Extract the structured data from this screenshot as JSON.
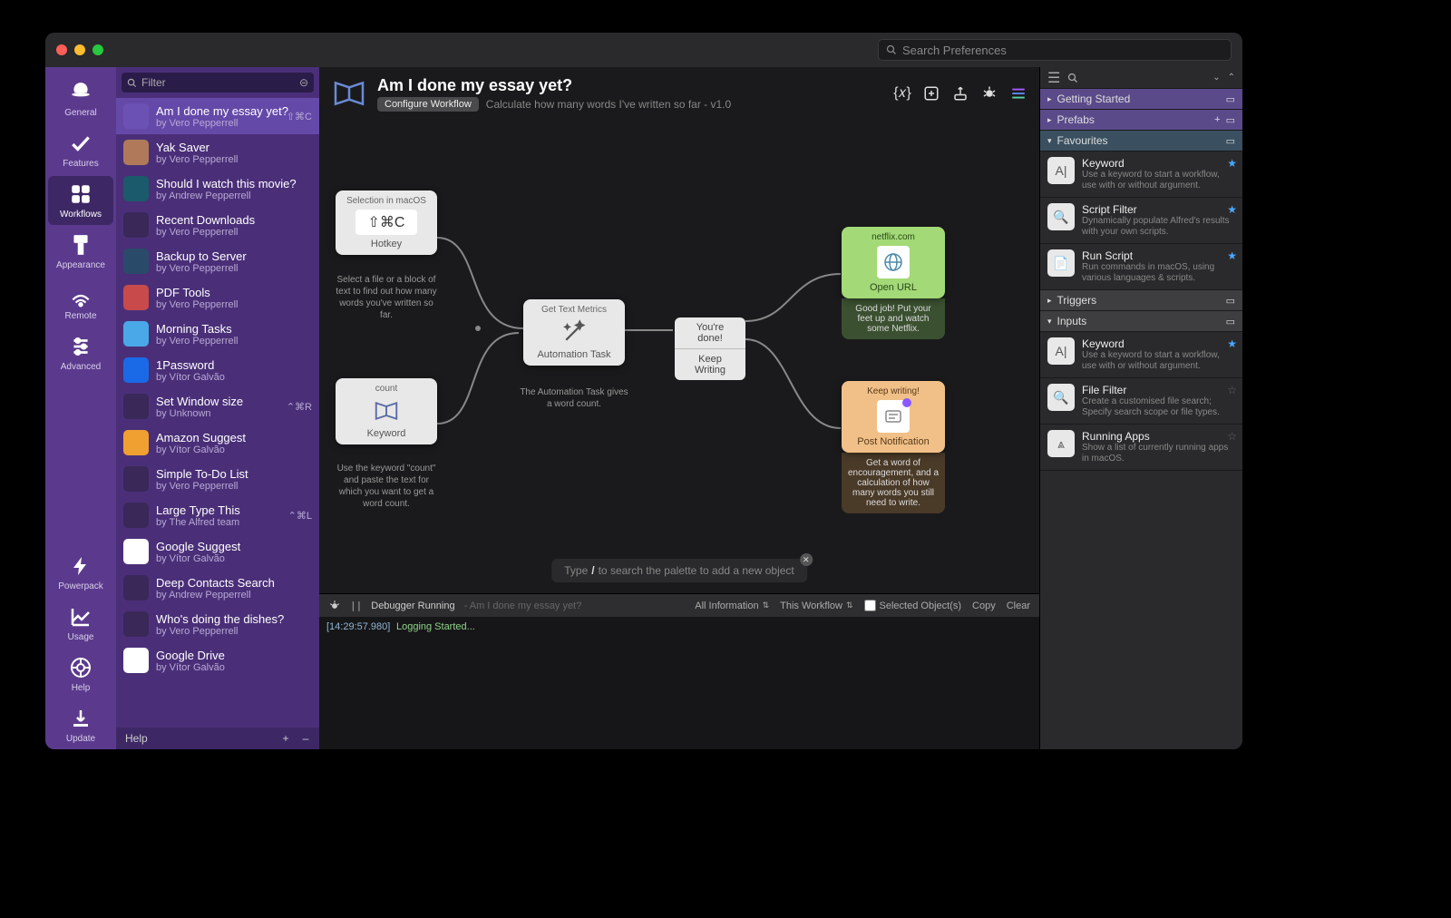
{
  "search_placeholder": "Search Preferences",
  "iconbar": [
    {
      "label": "General"
    },
    {
      "label": "Features"
    },
    {
      "label": "Workflows"
    },
    {
      "label": "Appearance"
    },
    {
      "label": "Remote"
    },
    {
      "label": "Advanced"
    },
    {
      "label": "Powerpack"
    },
    {
      "label": "Usage"
    },
    {
      "label": "Help"
    },
    {
      "label": "Update"
    }
  ],
  "filter_placeholder": "Filter",
  "workflows": [
    {
      "title": "Am I done my essay yet?",
      "author": "by Vero Pepperrell",
      "shortcut": "⇧⌘C",
      "selected": true,
      "icon_bg": "#6a51b3"
    },
    {
      "title": "Yak Saver",
      "author": "by Vero Pepperrell",
      "icon_bg": "#b07a5a"
    },
    {
      "title": "Should I watch this movie?",
      "author": "by Andrew Pepperrell",
      "icon_bg": "#1a5a6a"
    },
    {
      "title": "Recent Downloads",
      "author": "by Vero Pepperrell",
      "icon_bg": "#3a2858"
    },
    {
      "title": "Backup to Server",
      "author": "by Vero Pepperrell",
      "icon_bg": "#2a4a6a"
    },
    {
      "title": "PDF Tools",
      "author": "by Vero Pepperrell",
      "icon_bg": "#c84a4a"
    },
    {
      "title": "Morning Tasks",
      "author": "by Vero Pepperrell",
      "icon_bg": "#4aa8e8"
    },
    {
      "title": "1Password",
      "author": "by Vítor Galvão",
      "icon_bg": "#1a6ae8"
    },
    {
      "title": "Set Window size",
      "author": "by Unknown",
      "shortcut": "⌃⌘R",
      "icon_bg": "#3a2858"
    },
    {
      "title": "Amazon Suggest",
      "author": "by Vítor Galvão",
      "icon_bg": "#f0a030"
    },
    {
      "title": "Simple To-Do List",
      "author": "by Vero Pepperrell",
      "icon_bg": "#3a2858"
    },
    {
      "title": "Large Type This",
      "author": "by The Alfred team",
      "shortcut": "⌃⌘L",
      "icon_bg": "#3a2858"
    },
    {
      "title": "Google Suggest",
      "author": "by Vítor Galvão",
      "icon_bg": "#ffffff"
    },
    {
      "title": "Deep Contacts Search",
      "author": "by Andrew Pepperrell",
      "icon_bg": "#3a2858"
    },
    {
      "title": "Who's doing the dishes?",
      "author": "by Vero Pepperrell",
      "icon_bg": "#3a2858"
    },
    {
      "title": "Google Drive",
      "author": "by Vítor Galvão",
      "icon_bg": "#ffffff"
    }
  ],
  "wf_footer": {
    "help": "Help",
    "plus": "+",
    "minus": "–"
  },
  "header": {
    "title": "Am I done my essay yet?",
    "config": "Configure Workflow",
    "desc": "Calculate how many words I've written so far - v1.0"
  },
  "nodes": {
    "hotkey": {
      "top": "Selection in macOS",
      "main": "⇧⌘C",
      "bot": "Hotkey",
      "caption": "Select a file or a block of text to find out how many words you've written so far."
    },
    "keyword": {
      "top": "count",
      "bot": "Keyword",
      "caption": "Use the keyword \"count\" and paste the text for which you want to get a word count."
    },
    "metrics": {
      "top": "Get Text Metrics",
      "bot": "Automation Task",
      "caption": "The Automation Task gives a word count."
    },
    "split": {
      "top": "You're done!",
      "bot": "Keep Writing"
    },
    "url": {
      "top": "netflix.com",
      "bot": "Open URL",
      "caption": "Good job! Put your feet up and watch some Netflix."
    },
    "notif": {
      "top": "Keep writing!",
      "bot": "Post Notification",
      "caption": "Get a word of encouragement, and a calculation of how many words you still need to write."
    }
  },
  "palette_hint": {
    "pre": "Type ",
    "key": "/",
    "post": " to search the palette to add a new object"
  },
  "debugger": {
    "status": "Debugger Running",
    "context": "Am I done my essay yet?",
    "filter1": "All Information",
    "filter2": "This Workflow",
    "selected": "Selected Object(s)",
    "copy": "Copy",
    "clear": "Clear",
    "log_ts": "[14:29:57.980]",
    "log_msg": "Logging Started..."
  },
  "palette": {
    "sections": {
      "getting_started": "Getting Started",
      "prefabs": "Prefabs",
      "favourites": "Favourites",
      "triggers": "Triggers",
      "inputs": "Inputs"
    },
    "fav_items": [
      {
        "title": "Keyword",
        "desc": "Use a keyword to start a workflow, use with or without argument.",
        "glyph": "A|",
        "fav": true
      },
      {
        "title": "Script Filter",
        "desc": "Dynamically populate Alfred's results with your own scripts.",
        "glyph": "🔍",
        "fav": true
      },
      {
        "title": "Run Script",
        "desc": "Run commands in macOS, using various languages & scripts.",
        "glyph": "📄",
        "fav": true
      }
    ],
    "input_items": [
      {
        "title": "Keyword",
        "desc": "Use a keyword to start a workflow, use with or without argument.",
        "glyph": "A|",
        "fav": true
      },
      {
        "title": "File Filter",
        "desc": "Create a customised file search; Specify search scope or file types.",
        "glyph": "🔍",
        "fav": false
      },
      {
        "title": "Running Apps",
        "desc": "Show a list of currently running apps in macOS.",
        "glyph": "⩓",
        "fav": false
      }
    ]
  }
}
